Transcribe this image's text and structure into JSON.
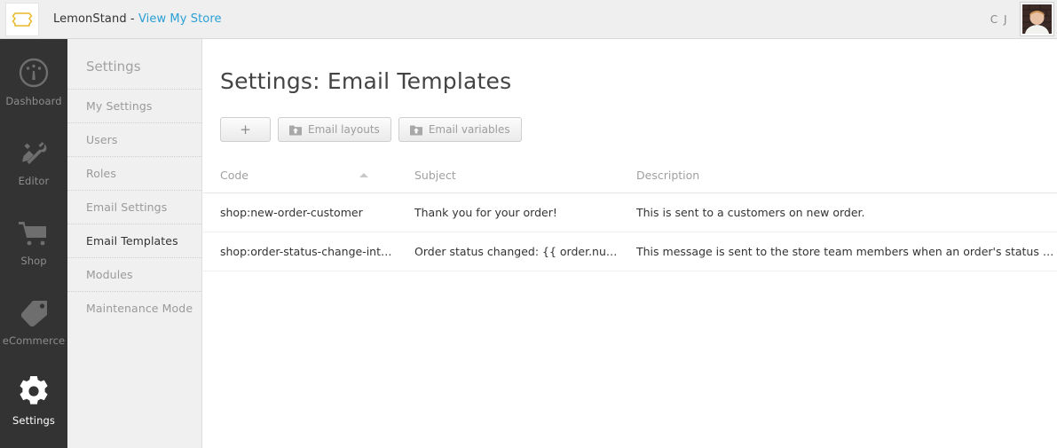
{
  "header": {
    "logo_icon": "lemonstand-bracket-logo-icon",
    "brand_prefix": "LemonStand - ",
    "brand_link": "View My Store",
    "user_initials": "C J",
    "avatar_icon": "user-avatar-photo"
  },
  "mainnav": {
    "items": [
      {
        "label": "Dashboard",
        "icon": "gauge-icon",
        "active": false
      },
      {
        "label": "Editor",
        "icon": "wrench-pencil-icon",
        "active": false
      },
      {
        "label": "Shop",
        "icon": "shopping-cart-icon",
        "active": false
      },
      {
        "label": "eCommerce",
        "icon": "price-tag-icon",
        "active": false
      },
      {
        "label": "Settings",
        "icon": "gear-icon",
        "active": true
      }
    ]
  },
  "subpanel": {
    "title": "Settings",
    "items": [
      {
        "label": "My Settings",
        "active": false
      },
      {
        "label": "Users",
        "active": false
      },
      {
        "label": "Roles",
        "active": false
      },
      {
        "label": "Email Settings",
        "active": false
      },
      {
        "label": "Email Templates",
        "active": true
      },
      {
        "label": "Modules",
        "active": false
      },
      {
        "label": "Maintenance Mode",
        "active": false
      }
    ]
  },
  "main": {
    "page_title": "Settings: Email Templates",
    "toolbar": {
      "add_label": "+",
      "email_layouts_label": "Email layouts",
      "email_variables_label": "Email variables",
      "button_icon": "folder-upload-icon"
    },
    "table": {
      "columns": [
        {
          "label": "Code",
          "sorted": "asc"
        },
        {
          "label": "Subject",
          "sorted": ""
        },
        {
          "label": "Description",
          "sorted": ""
        }
      ],
      "rows": [
        {
          "code": "shop:new-order-customer",
          "subject": "Thank you for your order!",
          "description": "This is sent to a customers on new order."
        },
        {
          "code": "shop:order-status-change-internal",
          "subject": "Order status changed: {{ order.number }}",
          "description": "This message is sent to the store team members when an order's status changes."
        }
      ]
    }
  },
  "colors": {
    "link": "#2a9fd6",
    "logo": "#e9b92c",
    "nav_bg": "#333333",
    "panel_bg": "#f0f0f0"
  }
}
